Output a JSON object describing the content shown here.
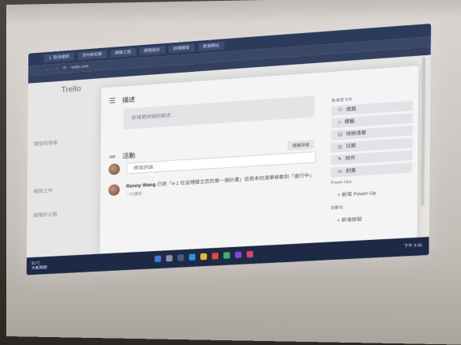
{
  "browser": {
    "tabs": [
      "1. 取消連結",
      "法內新紀錄",
      "網路工程",
      "網頁設計",
      "前端開發",
      "資源網站"
    ],
    "address": "trello.com"
  },
  "app": {
    "title": "Trello",
    "bg_labels": [
      "開發初學者",
      "網頁工作",
      "進階的主題"
    ]
  },
  "card": {
    "description_heading": "描述",
    "description_placeholder": "新增更詳細的敘述...",
    "activity_heading": "活動",
    "details_button": "隱藏詳細",
    "comment_placeholder": "撰寫評論",
    "activity": {
      "user": "Ronny Wang",
      "text": "已將「4-1 在這裡建立您的第一個計畫」從原本的清單移動到「進行中」",
      "time": "一分鐘前"
    }
  },
  "sidebar": {
    "add_to_card_label": "新增至卡片",
    "buttons": [
      {
        "icon": "user-icon",
        "label": "成員"
      },
      {
        "icon": "tag-icon",
        "label": "標籤"
      },
      {
        "icon": "checklist-icon",
        "label": "待辦清單"
      },
      {
        "icon": "clock-icon",
        "label": "日期"
      },
      {
        "icon": "paperclip-icon",
        "label": "附件"
      },
      {
        "icon": "cover-icon",
        "label": "封面"
      }
    ],
    "powerups_label": "Power-Ups",
    "add_powerup": "新增 Power-Up",
    "automation_label": "自動化",
    "add_button": "新增按鈕"
  },
  "taskbar": {
    "temperature": "31°C",
    "weather_text": "大致晴朗",
    "time": "下午 3:45"
  },
  "colors": {
    "taskbar": "#1d2a45",
    "browser_chrome": "#2c3a5c",
    "app_title": "#5a6f86"
  }
}
